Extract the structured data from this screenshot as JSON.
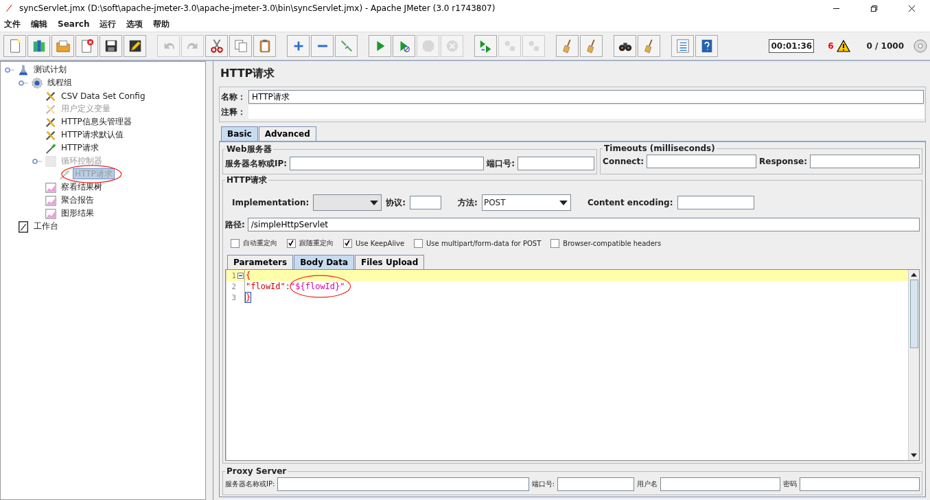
{
  "window": {
    "title": "syncServlet.jmx (D:\\soft\\apache-jmeter-3.0\\apache-jmeter-3.0\\bin\\syncServlet.jmx) - Apache JMeter (3.0 r1743807)"
  },
  "menu": [
    "文件",
    "编辑",
    "Search",
    "运行",
    "选项",
    "帮助"
  ],
  "toolbar": [
    [
      {
        "kind": "new",
        "disabled": false
      },
      {
        "kind": "templates",
        "disabled": false
      },
      {
        "kind": "open",
        "disabled": false
      },
      {
        "kind": "close",
        "disabled": false
      },
      {
        "kind": "save",
        "disabled": false
      },
      {
        "kind": "save-as",
        "disabled": false
      }
    ],
    [
      {
        "kind": "undo",
        "disabled": true
      },
      {
        "kind": "redo",
        "disabled": true
      },
      {
        "kind": "cut",
        "disabled": false
      },
      {
        "kind": "copy",
        "disabled": false
      },
      {
        "kind": "paste",
        "disabled": false
      }
    ],
    [
      {
        "kind": "expand",
        "disabled": false
      },
      {
        "kind": "collapse",
        "disabled": false
      },
      {
        "kind": "toggle",
        "disabled": false
      }
    ],
    [
      {
        "kind": "start",
        "disabled": false
      },
      {
        "kind": "start-no-timers",
        "disabled": false
      },
      {
        "kind": "stop",
        "disabled": true
      },
      {
        "kind": "shutdown",
        "disabled": true
      }
    ],
    [
      {
        "kind": "remote-start",
        "disabled": false
      },
      {
        "kind": "remote-stop",
        "disabled": true
      },
      {
        "kind": "remote-exit",
        "disabled": true
      }
    ],
    [
      {
        "kind": "clear",
        "disabled": false
      },
      {
        "kind": "clear-all",
        "disabled": false
      }
    ],
    [
      {
        "kind": "search",
        "disabled": false
      },
      {
        "kind": "reset-search",
        "disabled": false
      }
    ],
    [
      {
        "kind": "functions",
        "disabled": false
      },
      {
        "kind": "help",
        "disabled": false
      }
    ]
  ],
  "status": {
    "timer": "00:01:36",
    "warnings": "6",
    "threads": "0 / 1000"
  },
  "tree": [
    {
      "label": "测试计划",
      "kind": "flask",
      "disabled": false,
      "selected": false,
      "circled": false,
      "expanded": true,
      "children": [
        {
          "label": "线程组",
          "kind": "gear",
          "disabled": false,
          "selected": false,
          "circled": false,
          "expanded": true,
          "children": [
            {
              "label": "CSV Data Set Config",
              "kind": "tools",
              "disabled": false,
              "selected": false,
              "circled": false
            },
            {
              "label": "用户定义变量",
              "kind": "tools",
              "disabled": true,
              "selected": false,
              "circled": false
            },
            {
              "label": "HTTP信息头管理器",
              "kind": "tools",
              "disabled": false,
              "selected": false,
              "circled": false
            },
            {
              "label": "HTTP请求默认值",
              "kind": "tools",
              "disabled": false,
              "selected": false,
              "circled": false
            },
            {
              "label": "HTTP请求",
              "kind": "pipette",
              "disabled": false,
              "selected": false,
              "circled": false
            },
            {
              "label": "循环控制器",
              "kind": "controller",
              "disabled": true,
              "selected": false,
              "circled": false,
              "expanded": true,
              "children": [
                {
                  "label": "HTTP请求",
                  "kind": "pipette",
                  "disabled": true,
                  "selected": true,
                  "circled": true
                }
              ]
            },
            {
              "label": "察看结果树",
              "kind": "chart",
              "disabled": false,
              "selected": false,
              "circled": false
            },
            {
              "label": "聚合报告",
              "kind": "chart",
              "disabled": false,
              "selected": false,
              "circled": false
            },
            {
              "label": "图形结果",
              "kind": "chart",
              "disabled": false,
              "selected": false,
              "circled": false
            }
          ]
        }
      ]
    },
    {
      "label": "工作台",
      "kind": "notepad",
      "disabled": false,
      "selected": false,
      "circled": false
    }
  ],
  "panel": {
    "title": "HTTP请求",
    "name_label": "名称：",
    "name_value": "HTTP请求",
    "comment_label": "注释：",
    "tabs": [
      {
        "label": "Basic",
        "selected": true
      },
      {
        "label": "Advanced",
        "selected": false
      }
    ],
    "web_server": {
      "legend": "Web服务器",
      "server_label": "服务器名称或IP:",
      "port_label": "端口号:"
    },
    "timeouts": {
      "legend": "Timeouts (milliseconds)",
      "connect_label": "Connect:",
      "response_label": "Response:"
    },
    "http_request": {
      "legend": "HTTP请求",
      "implementation_label": "Implementation:",
      "protocol_label": "协议:",
      "method_label": "方法:",
      "method_value": "POST",
      "encoding_label": "Content encoding:",
      "path_label": "路径:",
      "path_value": "/simpleHttpServlet",
      "checkboxes": [
        {
          "label": "自动重定向",
          "checked": false
        },
        {
          "label": "跟随重定向",
          "checked": true
        },
        {
          "label": "Use KeepAlive",
          "checked": true
        },
        {
          "label": "Use multipart/form-data for POST",
          "checked": false
        },
        {
          "label": "Browser-compatible headers",
          "checked": false
        }
      ],
      "tabs": [
        {
          "label": "Parameters",
          "selected": false
        },
        {
          "label": "Body Data",
          "selected": true
        },
        {
          "label": "Files Upload",
          "selected": false
        }
      ],
      "editor": [
        {
          "number": "1",
          "current": true,
          "fold": true,
          "tokens": [
            {
              "text": "{",
              "kind": "brace",
              "circled": false
            }
          ]
        },
        {
          "number": "2",
          "current": false,
          "fold": false,
          "tokens": [
            {
              "text": "\"flowId\":",
              "kind": "key",
              "circled": false
            },
            {
              "text": "\"${flowId}\"",
              "kind": "string",
              "circled": true
            }
          ]
        },
        {
          "number": "3",
          "current": false,
          "fold": false,
          "tokens": [
            {
              "text": "}",
              "kind": "brace-match",
              "circled": false
            }
          ]
        }
      ]
    },
    "proxy": {
      "legend": "Proxy Server",
      "server_label": "服务器名称或IP:",
      "port_label": "端口号:",
      "user_label": "用户名",
      "password_label": "密码"
    }
  }
}
